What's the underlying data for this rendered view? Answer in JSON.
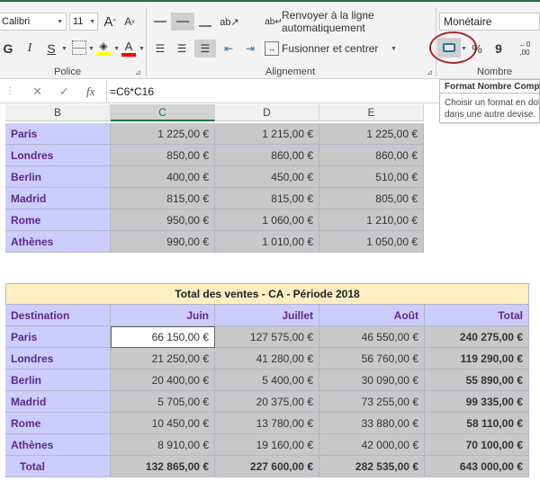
{
  "ribbon": {
    "font_name": "Calibri",
    "font_size": "11",
    "grow_font": "A",
    "shrink_font": "A",
    "bold": "G",
    "italic": "I",
    "underline": "S",
    "font_group_label": "Police",
    "wrap_text_label": "Renvoyer à la ligne automatiquement",
    "merge_center_label": "Fusionner et centrer",
    "alignment_group_label": "Alignement",
    "number_format_value": "Monétaire",
    "percent_symbol": "%",
    "comma_symbol": "9",
    "number_group_label": "Nombre",
    "highlight_color": "#b22222",
    "fill_color": "#ffff00",
    "font_color": "#ff0000"
  },
  "formula_bar": {
    "cancel": "✕",
    "enter": "✓",
    "fx": "fx",
    "formula": "=C6*C16"
  },
  "tooltip": {
    "title": "Format Nombre Compt",
    "line1": "Choisir un format en dol",
    "line2": "dans une autre devise."
  },
  "columns": [
    "B",
    "C",
    "D",
    "E"
  ],
  "table1": [
    {
      "city": "Paris",
      "c": "1 225,00 €",
      "d": "1 215,00 €",
      "e": "1 225,00 €"
    },
    {
      "city": "Londres",
      "c": "850,00 €",
      "d": "860,00 €",
      "e": "860,00 €"
    },
    {
      "city": "Berlin",
      "c": "400,00 €",
      "d": "450,00 €",
      "e": "510,00 €"
    },
    {
      "city": "Madrid",
      "c": "815,00 €",
      "d": "815,00 €",
      "e": "805,00 €"
    },
    {
      "city": "Rome",
      "c": "950,00 €",
      "d": "1 060,00 €",
      "e": "1 210,00 €"
    },
    {
      "city": "Athènes",
      "c": "990,00 €",
      "d": "1 010,00 €",
      "e": "1 050,00 €"
    }
  ],
  "table2": {
    "title": "Total des ventes - CA - Période 2018",
    "headers": [
      "Destination",
      "Juin",
      "Juillet",
      "Août",
      "Total"
    ],
    "rows": [
      {
        "city": "Paris",
        "juin": "66 150,00 €",
        "juillet": "127 575,00 €",
        "aout": "46 550,00 €",
        "total": "240 275,00 €"
      },
      {
        "city": "Londres",
        "juin": "21 250,00 €",
        "juillet": "41 280,00 €",
        "aout": "56 760,00 €",
        "total": "119 290,00 €"
      },
      {
        "city": "Berlin",
        "juin": "20 400,00 €",
        "juillet": "5 400,00 €",
        "aout": "30 090,00 €",
        "total": "55 890,00 €"
      },
      {
        "city": "Madrid",
        "juin": "5 705,00 €",
        "juillet": "20 375,00 €",
        "aout": "73 255,00 €",
        "total": "99 335,00 €"
      },
      {
        "city": "Rome",
        "juin": "10 450,00 €",
        "juillet": "13 780,00 €",
        "aout": "33 880,00 €",
        "total": "58 110,00 €"
      },
      {
        "city": "Athènes",
        "juin": "8 910,00 €",
        "juillet": "19 160,00 €",
        "aout": "42 000,00 €",
        "total": "70 100,00 €"
      }
    ],
    "total_row": {
      "label": "Total",
      "juin": "132 865,00 €",
      "juillet": "227 600,00 €",
      "aout": "282 535,00 €",
      "total": "643 000,00 €"
    }
  }
}
